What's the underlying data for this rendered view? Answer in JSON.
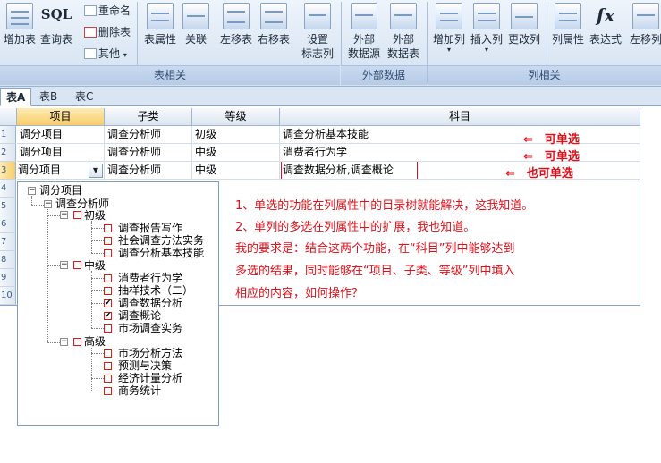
{
  "ribbon": {
    "add_table": "增加表",
    "sql_title": "SQL",
    "query_table": "查询表",
    "rename": "重命名",
    "delete_table": "删除表",
    "other": "其他",
    "table_props": "表属性",
    "relation": "关联",
    "move_left_table": "左移表",
    "move_right_table": "右移表",
    "set_flag_col": [
      "设置",
      "标志列"
    ],
    "external_ds": [
      "外部",
      "数据源"
    ],
    "external_data": [
      "外部",
      "数据表"
    ],
    "add_col": "增加列",
    "insert_col": "插入列",
    "change_col": "更改列",
    "col_props": "列属性",
    "expression": "表达式",
    "fx_label": "fx",
    "move_left_col": "左移列",
    "group_table": "表相关",
    "group_external": "外部数据",
    "group_col": "列相关"
  },
  "tabs": [
    "表A",
    "表B",
    "表C"
  ],
  "grid": {
    "headers": [
      "项目",
      "子类",
      "等级",
      "科目"
    ],
    "row_numbers": [
      "1",
      "2",
      "3",
      "4",
      "5",
      "6",
      "7",
      "8",
      "9",
      "10"
    ],
    "rows": [
      [
        "调分项目",
        "调查分析师",
        "初级",
        "调查分析基本技能"
      ],
      [
        "调分项目",
        "调查分析师",
        "中级",
        "消费者行为学"
      ],
      [
        "调分项目",
        "调查分析师",
        "中级",
        "调查数据分析,调查概论"
      ]
    ],
    "dropdown_arrow": "▼"
  },
  "annotations": {
    "row1": "可单选",
    "row2": "可单选",
    "row3": "也可单选",
    "arrow": "⇐"
  },
  "notes": [
    "1、单选的功能在列属性中的目录树就能解决，这我知道。",
    "2、单列的多选在列属性中的扩展，我也知道。",
    "我的要求是：结合这两个功能，在“科目”列中能够达到",
    "多选的结果，同时能够在“项目、子类、等级”列中填入",
    "相应的内容，如何操作？"
  ],
  "tree": {
    "root": "调分项目",
    "child": "调查分析师",
    "levels": [
      {
        "name": "初级",
        "items": [
          {
            "label": "调查报告写作",
            "checked": false
          },
          {
            "label": "社会调查方法实务",
            "checked": false
          },
          {
            "label": "调查分析基本技能",
            "checked": false
          }
        ]
      },
      {
        "name": "中级",
        "items": [
          {
            "label": "消费者行为学",
            "checked": false
          },
          {
            "label": "抽样技术（二）",
            "checked": false
          },
          {
            "label": "调查数据分析",
            "checked": true
          },
          {
            "label": "调查概论",
            "checked": true
          },
          {
            "label": "市场调查实务",
            "checked": false
          }
        ]
      },
      {
        "name": "高级",
        "items": [
          {
            "label": "市场分析方法",
            "checked": false
          },
          {
            "label": "预测与决策",
            "checked": false
          },
          {
            "label": "经济计量分析",
            "checked": false
          },
          {
            "label": "商务统计",
            "checked": false
          }
        ]
      }
    ],
    "minus": "−",
    "check": "✔"
  }
}
